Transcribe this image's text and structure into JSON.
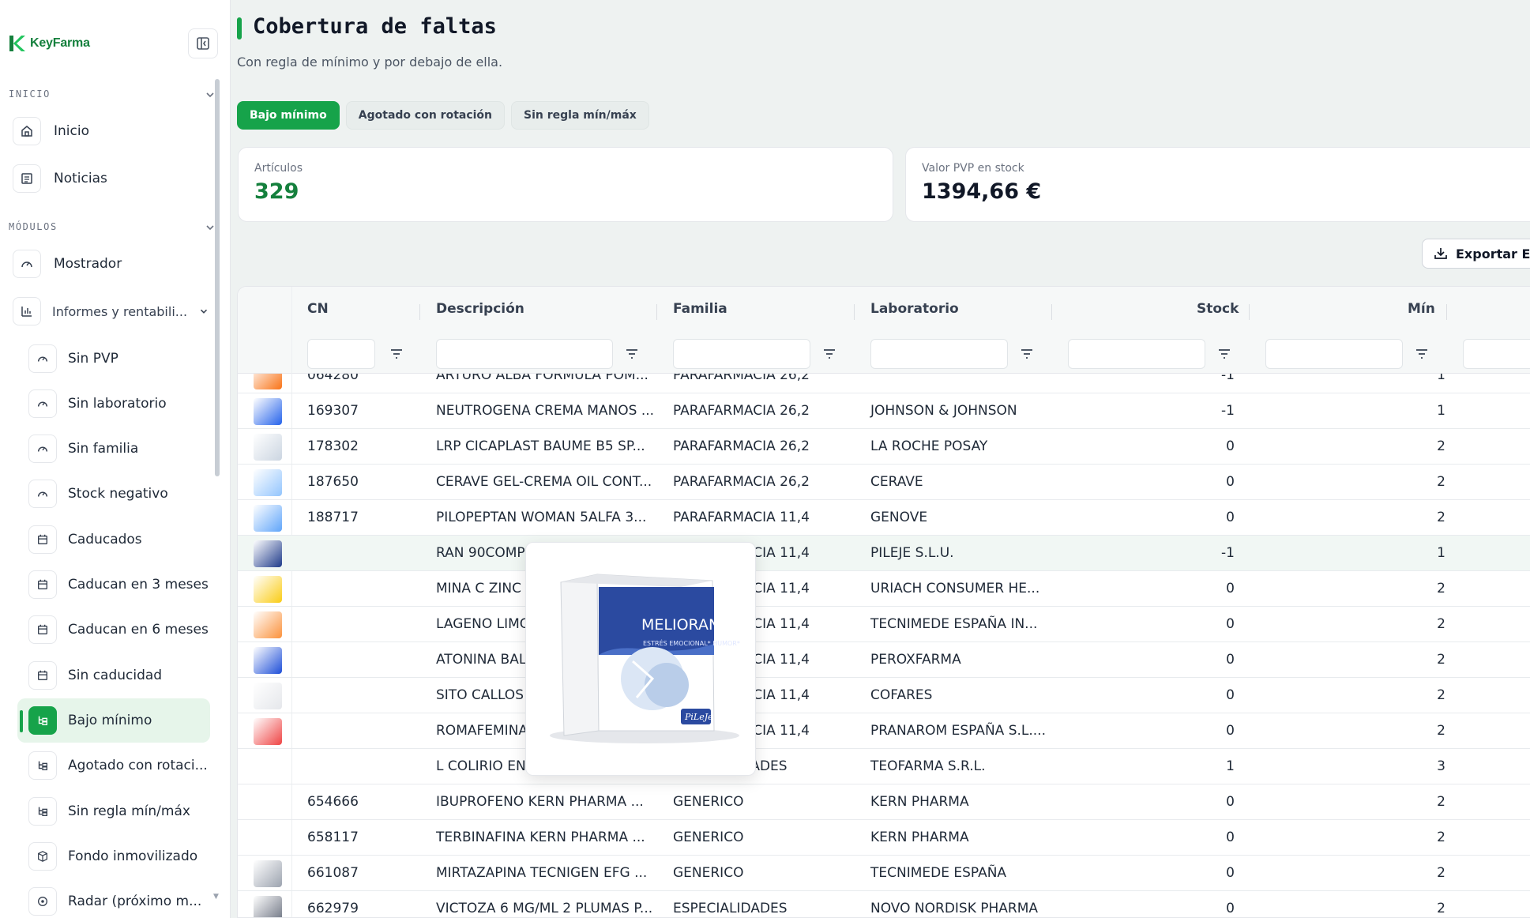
{
  "app": {
    "brand": "KeyFarma"
  },
  "sidebar": {
    "sections": [
      {
        "label": "INICIO"
      },
      {
        "label": "MÓDULOS"
      }
    ],
    "items": [
      {
        "label": "Inicio",
        "icon": "home-icon"
      },
      {
        "label": "Noticias",
        "icon": "newspaper-icon"
      },
      {
        "label": "Mostrador",
        "icon": "gauge-icon"
      },
      {
        "label": "Informes y rentabili...",
        "icon": "bar-chart-icon"
      },
      {
        "label": "Sin PVP",
        "icon": "gauge-icon"
      },
      {
        "label": "Sin laboratorio",
        "icon": "gauge-icon"
      },
      {
        "label": "Sin familia",
        "icon": "gauge-icon"
      },
      {
        "label": "Stock negativo",
        "icon": "gauge-icon"
      },
      {
        "label": "Caducados",
        "icon": "calendar-icon"
      },
      {
        "label": "Caducan en 3 meses",
        "icon": "calendar-icon"
      },
      {
        "label": "Caducan en 6 meses",
        "icon": "calendar-icon"
      },
      {
        "label": "Sin caducidad",
        "icon": "calendar-icon"
      },
      {
        "label": "Bajo mínimo",
        "icon": "tree-list-icon"
      },
      {
        "label": "Agotado con rotaci...",
        "icon": "tree-list-icon"
      },
      {
        "label": "Sin regla mín/máx",
        "icon": "tree-list-icon"
      },
      {
        "label": "Fondo inmovilizado",
        "icon": "box-icon"
      },
      {
        "label": "Radar (próximo m...",
        "icon": "radar-icon"
      }
    ]
  },
  "page": {
    "title": "Cobertura de faltas",
    "subtitle": "Con regla de mínimo y por debajo de ella.",
    "tabs": [
      "Bajo mínimo",
      "Agotado con rotación",
      "Sin regla mín/máx"
    ],
    "active_tab": "Bajo mínimo"
  },
  "kpis": [
    {
      "label": "Artículos",
      "value": "329"
    },
    {
      "label": "Valor PVP en stock",
      "value": "1394,66 €"
    }
  ],
  "export_label": "Exportar Ex",
  "table": {
    "columns": [
      "CN",
      "Descripción",
      "Familia",
      "Laboratorio",
      "Stock",
      "Mín"
    ],
    "rows": [
      {
        "cn": "064280",
        "desc": "ARTURO ALBA FORMULA POM...",
        "familia": "PARAFARMACIA 26,2",
        "lab": "",
        "stock": "-1",
        "min": "1"
      },
      {
        "cn": "169307",
        "desc": "NEUTROGENA CREMA MANOS ...",
        "familia": "PARAFARMACIA 26,2",
        "lab": "JOHNSON & JOHNSON",
        "stock": "-1",
        "min": "1"
      },
      {
        "cn": "178302",
        "desc": "LRP CICAPLAST BAUME B5 SP...",
        "familia": "PARAFARMACIA 26,2",
        "lab": "LA ROCHE POSAY",
        "stock": "0",
        "min": "2"
      },
      {
        "cn": "187650",
        "desc": "CERAVE GEL-CREMA OIL CONT...",
        "familia": "PARAFARMACIA 26,2",
        "lab": "CERAVE",
        "stock": "0",
        "min": "2"
      },
      {
        "cn": "188717",
        "desc": "PILOPEPTAN WOMAN 5ALFA 3...",
        "familia": "PARAFARMACIA 11,4",
        "lab": "GENOVE",
        "stock": "0",
        "min": "2"
      },
      {
        "cn": "",
        "desc": "RAN 90COMP",
        "familia": "PARAFARMACIA 11,4",
        "lab": "PILEJE S.L.U.",
        "stock": "-1",
        "min": "1"
      },
      {
        "cn": "",
        "desc": "MINA C ZINC 28...",
        "familia": "PARAFARMACIA 11,4",
        "lab": "URIACH CONSUMER HE...",
        "stock": "0",
        "min": "2"
      },
      {
        "cn": "",
        "desc": "LAGENO LIMON ...",
        "familia": "PARAFARMACIA 11,4",
        "lab": "TECNIMEDE ESPAÑA IN...",
        "stock": "0",
        "min": "2"
      },
      {
        "cn": "",
        "desc": "ATONINA BALAN...",
        "familia": "PARAFARMACIA 11,4",
        "lab": "PEROXFARMA",
        "stock": "0",
        "min": "2"
      },
      {
        "cn": "",
        "desc": "SITO CALLOS AC....",
        "familia": "PARAFARMACIA 11,4",
        "lab": "COFARES",
        "stock": "0",
        "min": "2"
      },
      {
        "cn": "",
        "desc": "ROMAFEMINA O...",
        "familia": "PARAFARMACIA 11,4",
        "lab": "PRANAROM ESPAÑA S.L....",
        "stock": "0",
        "min": "2"
      },
      {
        "cn": "",
        "desc": "L COLIRIO EN S...",
        "familia": "ESPECIALIDADES",
        "lab": "TEOFARMA S.R.L.",
        "stock": "1",
        "min": "3"
      },
      {
        "cn": "654666",
        "desc": "IBUPROFENO KERN PHARMA ...",
        "familia": "GENERICO",
        "lab": "KERN PHARMA",
        "stock": "0",
        "min": "2"
      },
      {
        "cn": "658117",
        "desc": "TERBINAFINA KERN PHARMA ...",
        "familia": "GENERICO",
        "lab": "KERN PHARMA",
        "stock": "0",
        "min": "2"
      },
      {
        "cn": "661087",
        "desc": "MIRTAZAPINA TECNIGEN EFG ...",
        "familia": "GENERICO",
        "lab": "TECNIMEDE ESPAÑA",
        "stock": "0",
        "min": "2"
      },
      {
        "cn": "662979",
        "desc": "VICTOZA 6 MG/ML 2 PLUMAS P...",
        "familia": "ESPECIALIDADES",
        "lab": "NOVO NORDISK PHARMA",
        "stock": "0",
        "min": "2"
      }
    ]
  },
  "popup": {
    "product_brand": "MELIORAN",
    "product_claim": "ESTRÉS EMOCIONAL* HUMOR*",
    "product_maker": "PiLeJe"
  },
  "colors": {
    "accent": "#16a34a",
    "accent_light": "#e6f5ea"
  }
}
